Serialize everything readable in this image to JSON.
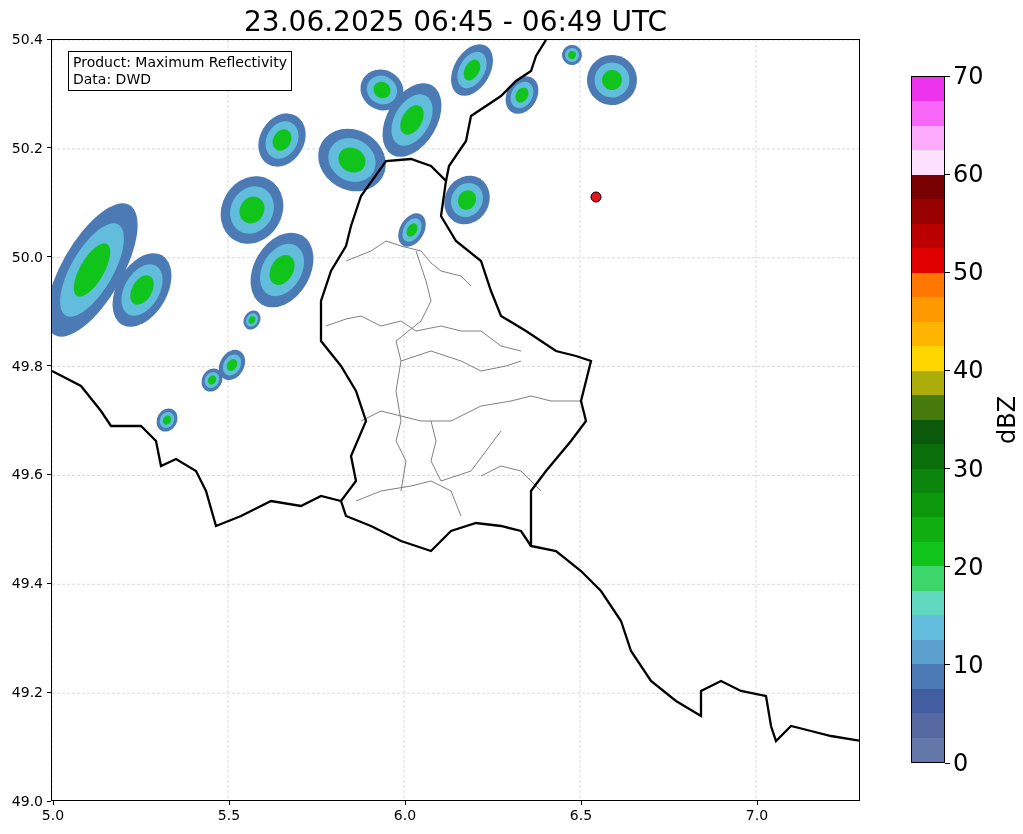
{
  "title": "23.06.2025 06:45 - 06:49 UTC",
  "info_box": {
    "lines": [
      "Product: Maximum Reflectivity",
      "Data: DWD"
    ]
  },
  "axes": {
    "yticks": [
      "50.4",
      "50.2",
      "50.0",
      "49.8",
      "49.6",
      "49.4",
      "49.2",
      "49.0"
    ],
    "xticks": [
      "5.0",
      "5.5",
      "6.0",
      "6.5",
      "7.0"
    ]
  },
  "colorbar": {
    "label": "dBZ",
    "ticks": [
      "70",
      "60",
      "50",
      "40",
      "30",
      "20",
      "10",
      "0"
    ],
    "segments": [
      {
        "color": "#6377a8"
      },
      {
        "color": "#55689f"
      },
      {
        "color": "#425ea0"
      },
      {
        "color": "#4b7ab5"
      },
      {
        "color": "#5ba0cc"
      },
      {
        "color": "#62bcdc"
      },
      {
        "color": "#60d9c0"
      },
      {
        "color": "#3dd66a"
      },
      {
        "color": "#10c41c"
      },
      {
        "color": "#0eaf0e"
      },
      {
        "color": "#0c9a0c"
      },
      {
        "color": "#0b850b"
      },
      {
        "color": "#0a6e0a"
      },
      {
        "color": "#0b5a0b"
      },
      {
        "color": "#477a0d"
      },
      {
        "color": "#adad0a"
      },
      {
        "color": "#ffd700"
      },
      {
        "color": "#ffb400"
      },
      {
        "color": "#ff9900"
      },
      {
        "color": "#ff7700"
      },
      {
        "color": "#e00000"
      },
      {
        "color": "#bb0000"
      },
      {
        "color": "#990000"
      },
      {
        "color": "#780000"
      },
      {
        "color": "#fde0fd"
      },
      {
        "color": "#fcaafc"
      },
      {
        "color": "#f766f7"
      },
      {
        "color": "#ee33ee"
      }
    ]
  }
}
